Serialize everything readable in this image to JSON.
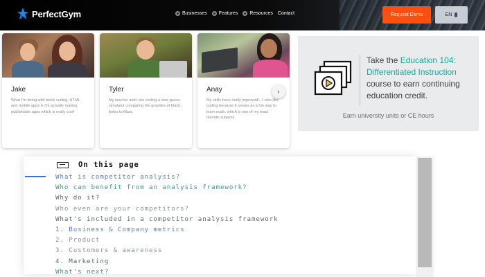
{
  "nav": {
    "brand": "PerfectGym",
    "links": [
      "Businesses",
      "Features",
      "Resources",
      "Contact"
    ],
    "demo_label": "Request Demo",
    "lang_label": "EN",
    "brand_color": "#1e88e5",
    "demo_color": "#ff4f0f"
  },
  "testimonials": [
    {
      "name": "Jake",
      "quote": "What I'm doing with block coding, HTML and mobile apps is I'm actually making publishable apps which is really cool!"
    },
    {
      "name": "Tyler",
      "quote": "My teacher and I are coding a new space simulator comparing the gravities of black holes to Mars."
    },
    {
      "name": "Anay",
      "quote": "My skills have really improved!...I also like coding because it serves as a fun way to learn math, which is one of my least favorite subjects."
    }
  ],
  "carousel": {
    "next_icon": "chevron-right-icon",
    "next_glyph": "›"
  },
  "education": {
    "prefix": "Take the ",
    "course": "Education 104: Differentiated Instruction",
    "suffix": " course to earn continuing education credit.",
    "footer": "Earn university units or CE hours",
    "icon": "video-play-icon",
    "accent": "#1ba69c"
  },
  "toc": {
    "title": "On this page",
    "items": [
      "What is competitor analysis?",
      "Who can benefit from an analysis framework?",
      "Why do it?",
      "Who even are your competitors?",
      "What's included in a competitor analysis framework",
      "1. Business & Company metrics",
      "2. Product",
      "3. Customers & awareness",
      "4. Marketing",
      "What's next?"
    ]
  }
}
